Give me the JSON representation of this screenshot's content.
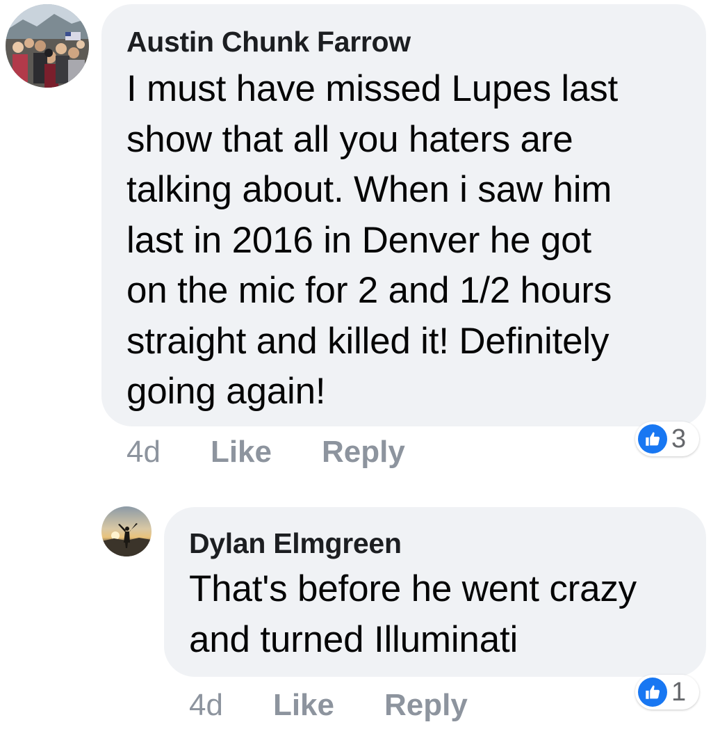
{
  "comments": [
    {
      "author": "Austin Chunk Farrow",
      "text": "I must have missed Lupes last\nshow that all you haters are\ntalking about. When i saw him\nlast in 2016 in Denver he got\non the mic for 2 and 1/2 hours\nstraight and killed it! Definitely\ngoing again!",
      "time": "4d",
      "like_label": "Like",
      "reply_label": "Reply",
      "reaction_count": "3",
      "reaction_icon": "thumbs-up-icon"
    },
    {
      "author": "Dylan Elmgreen",
      "text": "That's before he went crazy\nand turned Illuminati",
      "time": "4d",
      "like_label": "Like",
      "reply_label": "Reply",
      "reaction_count": "1",
      "reaction_icon": "thumbs-up-icon"
    }
  ],
  "colors": {
    "bubble": "#f0f2f5",
    "author": "#1c1e21",
    "text": "#050505",
    "meta": "#8d949e",
    "like_blue": "#1877f2"
  }
}
